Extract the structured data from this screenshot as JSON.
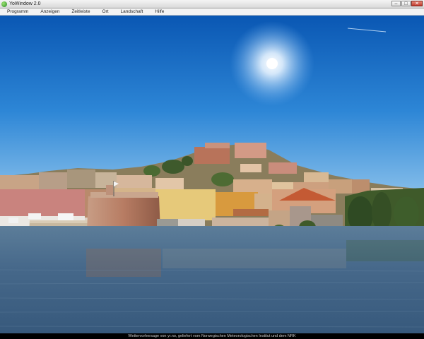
{
  "window": {
    "title": "YoWindow 2.0"
  },
  "window_controls": {
    "minimize": "–",
    "maximize": "□",
    "close": "✕"
  },
  "menu": [
    "Programm",
    "Anzeigen",
    "Zeitleiste",
    "Ort",
    "Landschaft",
    "Hilfe"
  ],
  "status_text": "Wettervorhersage von yr.no, geliefert vom Norwegischen Meteorologischen Institut und dem NRK",
  "colors": {
    "sky_top": "#0a5bb8",
    "sky_horizon": "#8fc4ec",
    "water": "#3d5f7f",
    "status_bg": "#000000"
  }
}
